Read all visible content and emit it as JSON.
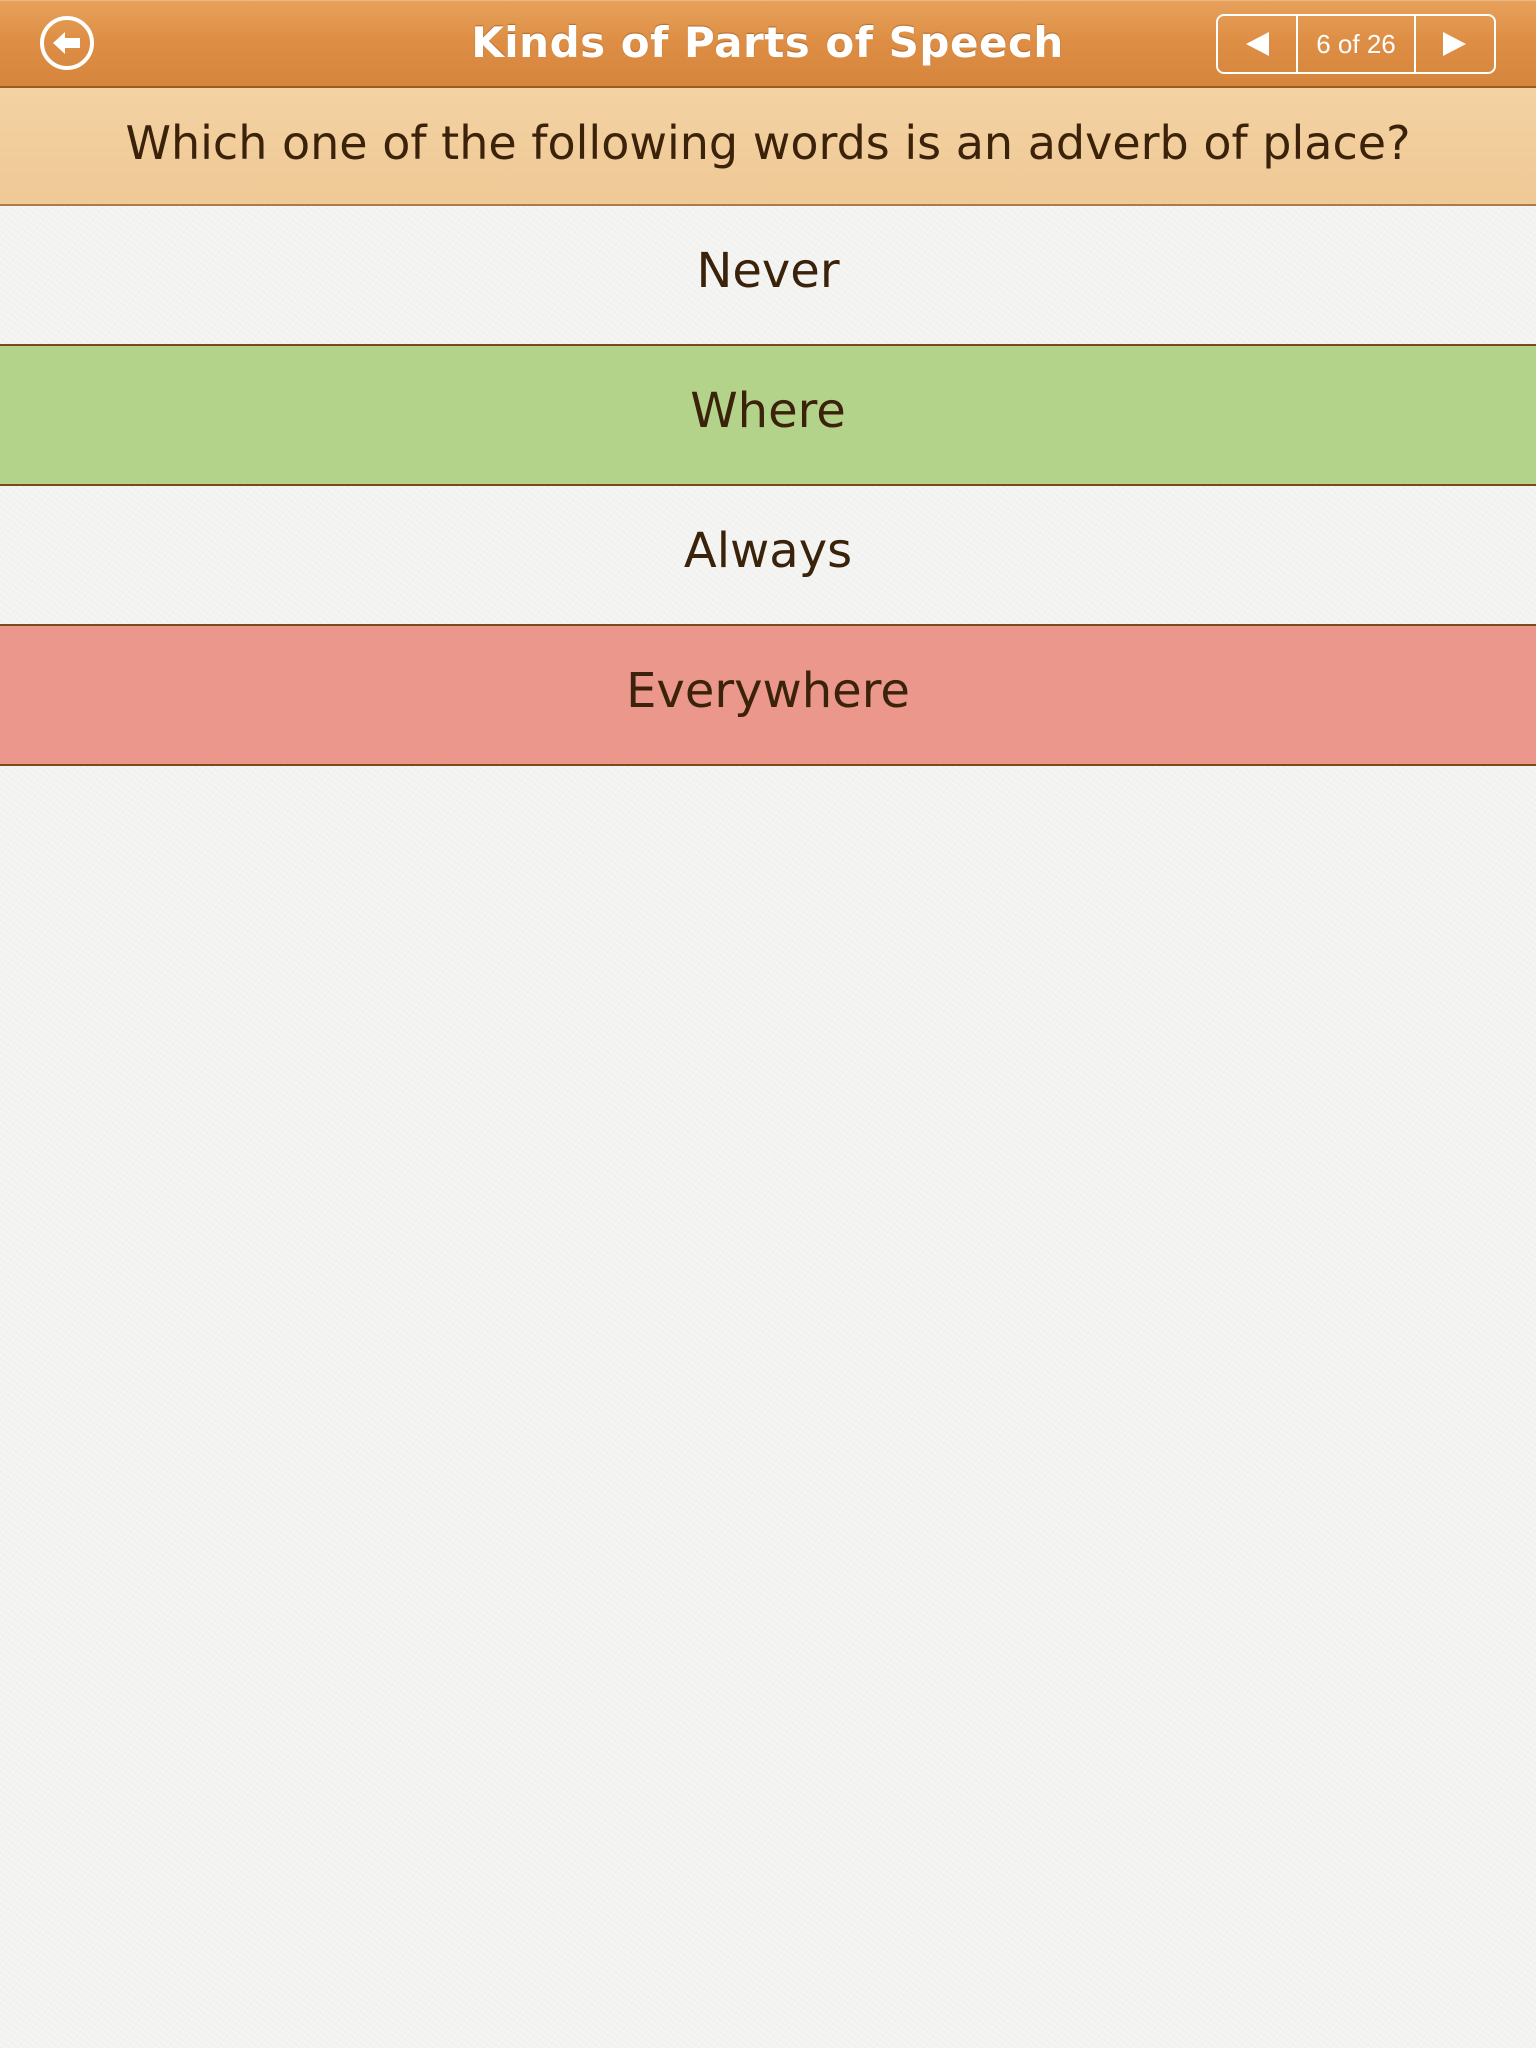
{
  "nav": {
    "title": "Kinds of Parts of Speech",
    "back_icon": "back-arrow-icon",
    "prev_icon": "triangle-left-icon",
    "next_icon": "triangle-right-icon",
    "page_indicator": "6 of 26",
    "bar_color": "#de8f45"
  },
  "question": {
    "text": "Which one of the following words is an adverb of place?",
    "banner_color": "#f1cd9c"
  },
  "answers": [
    {
      "label": "Never",
      "state": "neutral"
    },
    {
      "label": "Where",
      "state": "correct",
      "color": "#b3d38b"
    },
    {
      "label": "Always",
      "state": "neutral"
    },
    {
      "label": "Everywhere",
      "state": "wrong",
      "color": "#eb978b"
    }
  ]
}
